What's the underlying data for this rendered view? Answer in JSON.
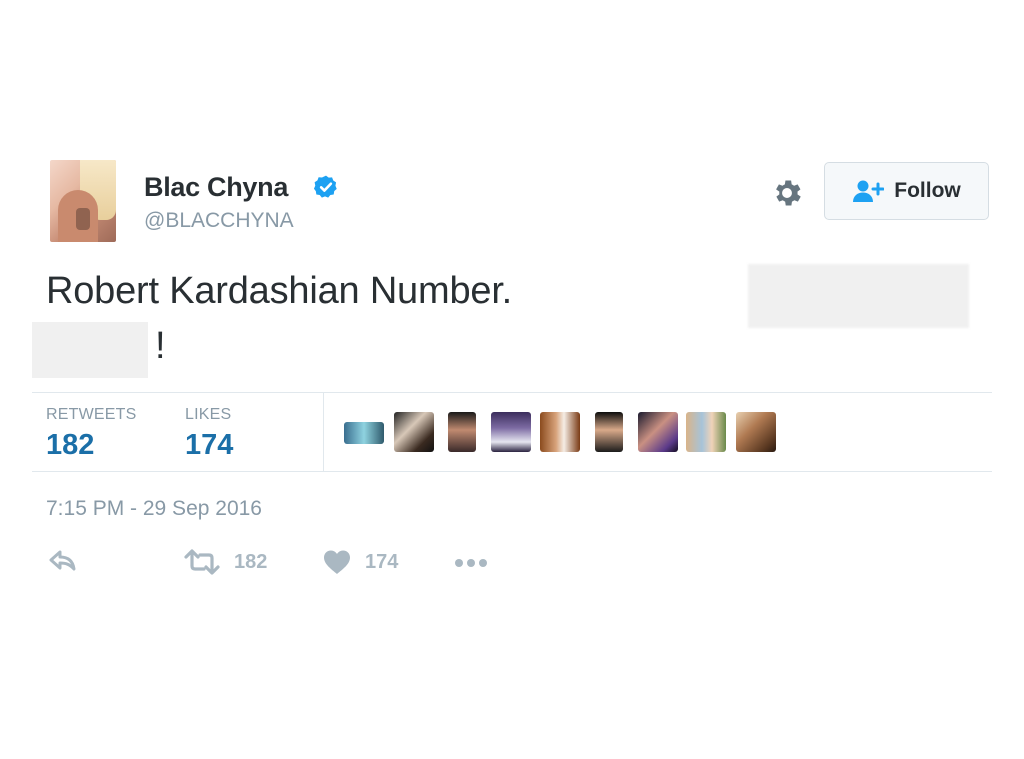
{
  "header": {
    "display_name": "Blac Chyna",
    "handle": "@BLACCHYNA",
    "verified": true,
    "follow_label": "Follow"
  },
  "tweet": {
    "text_line1": "Robert Kardashian Number.",
    "text_line2": "!"
  },
  "stats": {
    "retweets_label": "RETWEETS",
    "retweets_value": "182",
    "likes_label": "LIKES",
    "likes_value": "174"
  },
  "timestamp": "7:15 PM - 29 Sep 2016",
  "actions": {
    "retweet_count": "182",
    "like_count": "174"
  },
  "icons": [
    "verified-badge-icon",
    "gear-icon",
    "follow-person-icon",
    "reply-icon",
    "retweet-icon",
    "heart-icon",
    "more-icon"
  ],
  "colors": {
    "text": "#292f33",
    "muted": "#8899a6",
    "stat_value": "#1b6fa8",
    "verified": "#1da1f2",
    "action": "#aab8c2"
  }
}
